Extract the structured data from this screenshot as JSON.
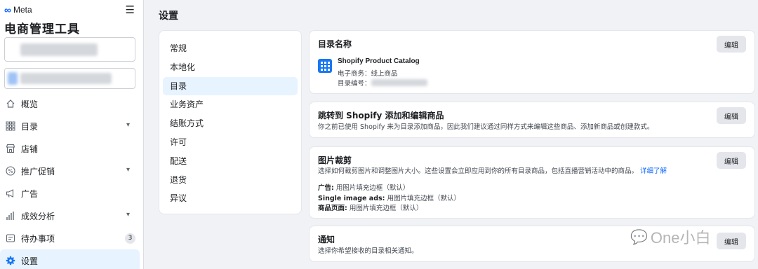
{
  "brand": {
    "logo_text": "Meta",
    "app_title": "电商管理工具"
  },
  "nav": {
    "items": [
      {
        "label": "概览",
        "icon": "home-icon",
        "chevron": ""
      },
      {
        "label": "目录",
        "icon": "grid-icon",
        "chevron": "⌄"
      },
      {
        "label": "店铺",
        "icon": "store-icon",
        "chevron": ""
      },
      {
        "label": "推广促销",
        "icon": "percent-icon",
        "chevron": "⌄"
      },
      {
        "label": "广告",
        "icon": "megaphone-icon",
        "chevron": ""
      },
      {
        "label": "成效分析",
        "icon": "bar-chart-icon",
        "chevron": "⌄"
      },
      {
        "label": "待办事项",
        "icon": "todo-icon",
        "badge": "3"
      },
      {
        "label": "设置",
        "icon": "gear-icon",
        "active": true
      }
    ]
  },
  "page": {
    "title": "设置"
  },
  "submenu": {
    "items": [
      "常规",
      "本地化",
      "目录",
      "业务资产",
      "结账方式",
      "许可",
      "配送",
      "退货",
      "异议"
    ],
    "active_index": 2
  },
  "cards": {
    "catalog": {
      "title": "目录名称",
      "edit": "编辑",
      "catalog_name": "Shopify Product Catalog",
      "type_line": "电子商务：线上商品",
      "id_label": "目录编号："
    },
    "shopify": {
      "title": "跳转到 Shopify 添加和编辑商品",
      "edit": "编辑",
      "desc": "你之前已使用 Shopify 来为目录添加商品，因此我们建议通过同样方式来编辑这些商品、添加新商品或创建款式。"
    },
    "crop": {
      "title": "图片裁剪",
      "edit": "编辑",
      "desc": "选择如何裁剪图片和调整图片大小。这些设置会立即应用到你的所有目录商品，包括直播营销活动中的商品。",
      "link": "详细了解",
      "ads_label": "广告:",
      "ads_value": "用图片填充边框（默认）",
      "single_label": "Single image ads:",
      "single_value": "用图片填充边框（默认）",
      "product_label": "商品页面:",
      "product_value": "用图片填充边框（默认）"
    },
    "notify": {
      "title": "通知",
      "edit": "编辑",
      "desc": "选择你希望接收的目录相关通知。"
    }
  },
  "watermark": {
    "text": "One小白"
  },
  "colors": {
    "accent": "#0866ff",
    "active_bg": "#e7f3ff",
    "page_bg": "#f0f2f5"
  }
}
